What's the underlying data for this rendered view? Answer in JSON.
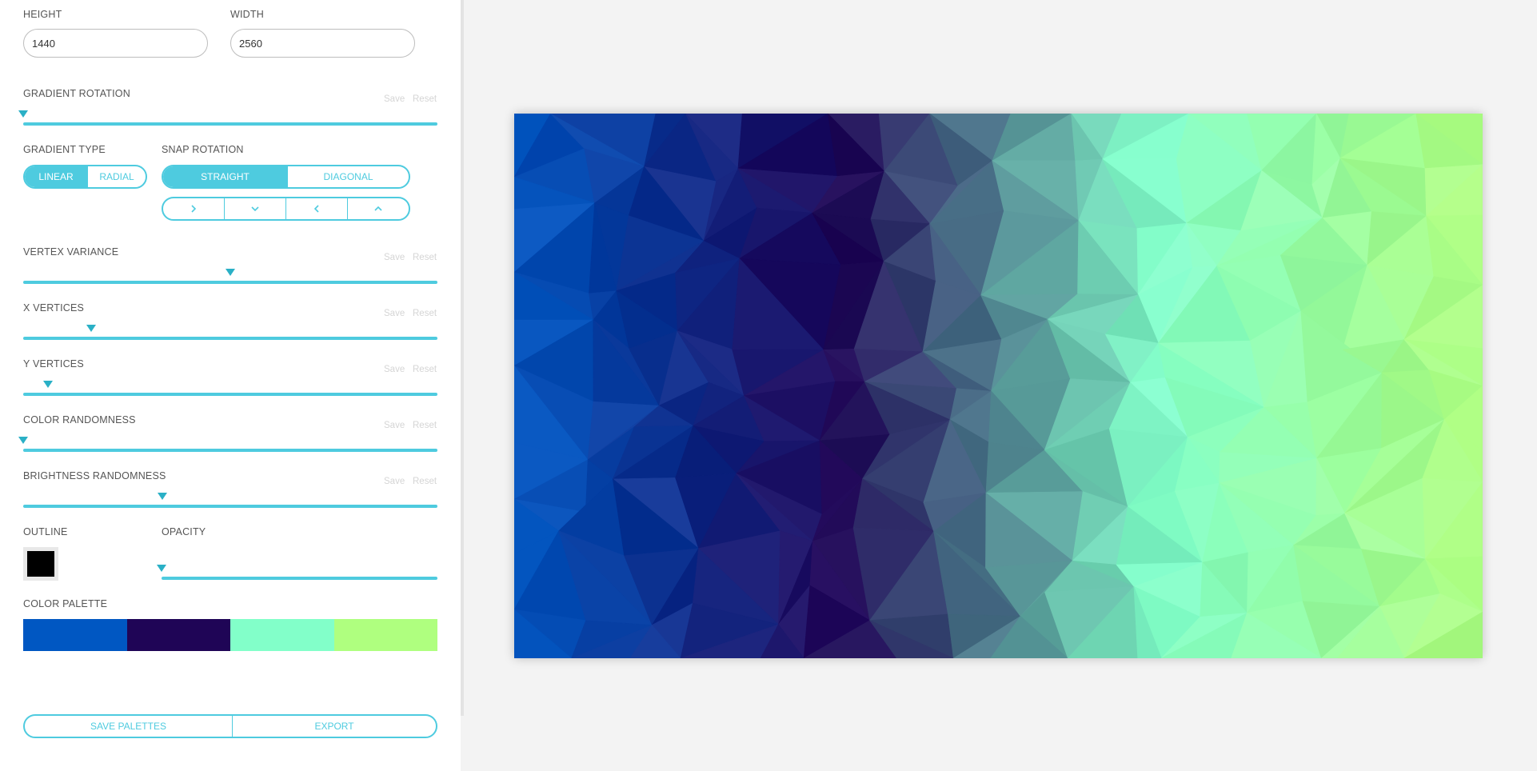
{
  "dimensions": {
    "height_label": "HEIGHT",
    "height_value": "1440",
    "width_label": "WIDTH",
    "width_value": "2560"
  },
  "gradient_rotation": {
    "label": "GRADIENT ROTATION",
    "save": "Save",
    "reset": "Reset",
    "value": 0.0
  },
  "gradient_type": {
    "label": "GRADIENT TYPE",
    "options": [
      "LINEAR",
      "RADIAL"
    ],
    "selected": "LINEAR"
  },
  "snap_rotation": {
    "label": "SNAP ROTATION",
    "modes": [
      "STRAIGHT",
      "DIAGONAL"
    ],
    "selected": "STRAIGHT",
    "directions": [
      "chevron-right-icon",
      "chevron-down-icon",
      "chevron-left-icon",
      "chevron-up-icon"
    ]
  },
  "vertex_variance": {
    "label": "VERTEX VARIANCE",
    "save": "Save",
    "reset": "Reset",
    "value": 0.5
  },
  "x_vertices": {
    "label": "X VERTICES",
    "save": "Save",
    "reset": "Reset",
    "value": 0.165
  },
  "y_vertices": {
    "label": "Y VERTICES",
    "save": "Save",
    "reset": "Reset",
    "value": 0.06
  },
  "color_randomness": {
    "label": "COLOR RANDOMNESS",
    "save": "Save",
    "reset": "Reset",
    "value": 0.0
  },
  "brightness_randomness": {
    "label": "BRIGHTNESS RANDOMNESS",
    "save": "Save",
    "reset": "Reset",
    "value": 0.335
  },
  "outline": {
    "label": "OUTLINE",
    "color": "#000000"
  },
  "opacity": {
    "label": "OPACITY",
    "value": 0.0
  },
  "color_palette": {
    "label": "COLOR PALETTE",
    "colors": [
      "#0057c2",
      "#1f0556",
      "#82ffc9",
      "#afff7f"
    ]
  },
  "buttons": {
    "save_palettes": "SAVE PALETTES",
    "export": "EXPORT"
  },
  "colors": {
    "accent": "#4ecbdf",
    "thumb": "#2ab0c6"
  }
}
